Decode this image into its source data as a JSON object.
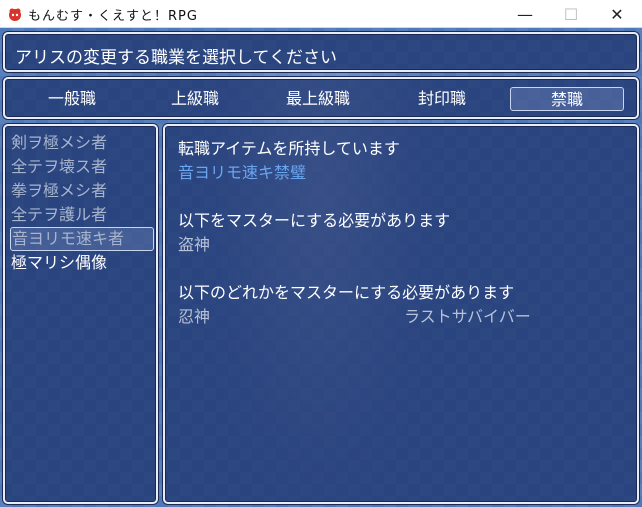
{
  "window": {
    "title": "もんむす・くえすと！RPG",
    "minimize": "—",
    "maximize": "☐",
    "close": "✕",
    "icon": "app-red-creature-icon"
  },
  "header": {
    "text": "アリスの変更する職業を選択してください"
  },
  "tabs": [
    {
      "label": "一般職"
    },
    {
      "label": "上級職"
    },
    {
      "label": "最上級職"
    },
    {
      "label": "封印職"
    },
    {
      "label": "禁職"
    }
  ],
  "active_tab": 4,
  "job_list": [
    {
      "label": "剣ヲ極メシ者",
      "state": "dim"
    },
    {
      "label": "全テヲ壊ス者",
      "state": "dim"
    },
    {
      "label": "拳ヲ極メシ者",
      "state": "dim"
    },
    {
      "label": "全テヲ護ル者",
      "state": "dim"
    },
    {
      "label": "音ヨリモ速キ者",
      "state": "selected"
    },
    {
      "label": "極マリシ偶像",
      "state": "normal"
    }
  ],
  "detail": {
    "item_heading": "転職アイテムを所持しています",
    "item_name": "音ヨリモ速キ禁璧",
    "req_all_heading": "以下をマスターにする必要があります",
    "req_all": [
      "盗神"
    ],
    "req_any_heading": "以下のどれかをマスターにする必要があります",
    "req_any": [
      "忍神",
      "ラストサバイバー"
    ]
  },
  "colors": {
    "panel": "#1c3069",
    "border": "#e8ecf5",
    "accent_text": "#6aa6f0",
    "dim_text": "#a8b4cc"
  }
}
